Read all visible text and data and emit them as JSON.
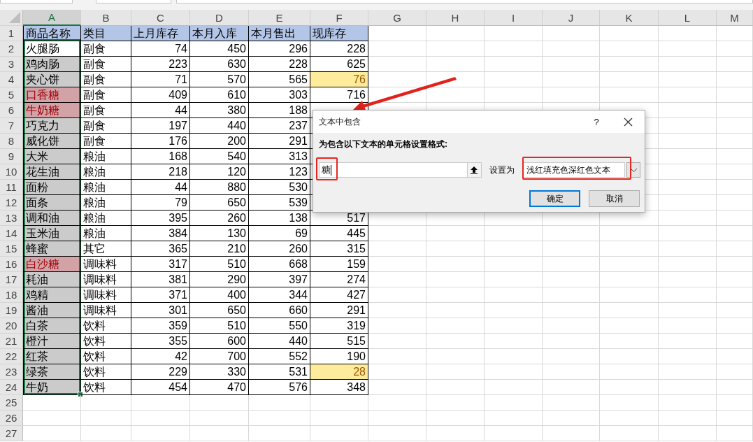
{
  "columns": [
    {
      "label": "A",
      "selected": true
    },
    {
      "label": "B",
      "selected": false
    },
    {
      "label": "C",
      "selected": false
    },
    {
      "label": "D",
      "selected": false
    },
    {
      "label": "E",
      "selected": false
    },
    {
      "label": "F",
      "selected": false
    },
    {
      "label": "G",
      "selected": false
    },
    {
      "label": "H",
      "selected": false
    },
    {
      "label": "I",
      "selected": false
    },
    {
      "label": "J",
      "selected": false
    },
    {
      "label": "K",
      "selected": false
    },
    {
      "label": "L",
      "selected": false
    },
    {
      "label": "M",
      "selected": false
    }
  ],
  "header_row": {
    "number": "1",
    "cells": [
      "商品名称",
      "类目",
      "上月库存",
      "本月入库",
      "本月售出",
      "现库存"
    ]
  },
  "data_rows": [
    {
      "number": "2",
      "name": "火腿肠",
      "name_active": true,
      "name_highlighted": false,
      "category": "副食",
      "last_month": "74",
      "received": "450",
      "sold": "296",
      "stock": "228",
      "stock_low": false
    },
    {
      "number": "3",
      "name": "鸡肉肠",
      "name_active": false,
      "name_highlighted": false,
      "category": "副食",
      "last_month": "223",
      "received": "630",
      "sold": "228",
      "stock": "625",
      "stock_low": false
    },
    {
      "number": "4",
      "name": "夹心饼",
      "name_active": false,
      "name_highlighted": false,
      "category": "副食",
      "last_month": "71",
      "received": "570",
      "sold": "565",
      "stock": "76",
      "stock_low": true
    },
    {
      "number": "5",
      "name": "口香糖",
      "name_active": false,
      "name_highlighted": true,
      "category": "副食",
      "last_month": "409",
      "received": "610",
      "sold": "303",
      "stock": "716",
      "stock_low": false
    },
    {
      "number": "6",
      "name": "牛奶糖",
      "name_active": false,
      "name_highlighted": true,
      "category": "副食",
      "last_month": "44",
      "received": "380",
      "sold": "188"
    },
    {
      "number": "7",
      "name": "巧克力",
      "name_active": false,
      "name_highlighted": false,
      "category": "副食",
      "last_month": "197",
      "received": "440",
      "sold": "237"
    },
    {
      "number": "8",
      "name": "威化饼",
      "name_active": false,
      "name_highlighted": false,
      "category": "副食",
      "last_month": "176",
      "received": "200",
      "sold": "291"
    },
    {
      "number": "9",
      "name": "大米",
      "name_active": false,
      "name_highlighted": false,
      "category": "粮油",
      "last_month": "168",
      "received": "540",
      "sold": "313"
    },
    {
      "number": "10",
      "name": "花生油",
      "name_active": false,
      "name_highlighted": false,
      "category": "粮油",
      "last_month": "218",
      "received": "120",
      "sold": "123"
    },
    {
      "number": "11",
      "name": "面粉",
      "name_active": false,
      "name_highlighted": false,
      "category": "粮油",
      "last_month": "44",
      "received": "880",
      "sold": "530"
    },
    {
      "number": "12",
      "name": "面条",
      "name_active": false,
      "name_highlighted": false,
      "category": "粮油",
      "last_month": "79",
      "received": "650",
      "sold": "539"
    },
    {
      "number": "13",
      "name": "调和油",
      "name_active": false,
      "name_highlighted": false,
      "category": "粮油",
      "last_month": "395",
      "received": "260",
      "sold": "138",
      "stock": "517",
      "stock_low": false
    },
    {
      "number": "14",
      "name": "玉米油",
      "name_active": false,
      "name_highlighted": false,
      "category": "粮油",
      "last_month": "384",
      "received": "130",
      "sold": "69",
      "stock": "445",
      "stock_low": false
    },
    {
      "number": "15",
      "name": "蜂蜜",
      "name_active": false,
      "name_highlighted": false,
      "category": "其它",
      "last_month": "365",
      "received": "210",
      "sold": "260",
      "stock": "315",
      "stock_low": false
    },
    {
      "number": "16",
      "name": "白沙糖",
      "name_active": false,
      "name_highlighted": true,
      "category": "调味料",
      "last_month": "317",
      "received": "510",
      "sold": "668",
      "stock": "159",
      "stock_low": false
    },
    {
      "number": "17",
      "name": "耗油",
      "name_active": false,
      "name_highlighted": false,
      "category": "调味料",
      "last_month": "381",
      "received": "290",
      "sold": "397",
      "stock": "274",
      "stock_low": false
    },
    {
      "number": "18",
      "name": "鸡精",
      "name_active": false,
      "name_highlighted": false,
      "category": "调味料",
      "last_month": "371",
      "received": "400",
      "sold": "344",
      "stock": "427",
      "stock_low": false
    },
    {
      "number": "19",
      "name": "酱油",
      "name_active": false,
      "name_highlighted": false,
      "category": "调味料",
      "last_month": "301",
      "received": "650",
      "sold": "660",
      "stock": "291",
      "stock_low": false
    },
    {
      "number": "20",
      "name": "白茶",
      "name_active": false,
      "name_highlighted": false,
      "category": "饮料",
      "last_month": "359",
      "received": "510",
      "sold": "550",
      "stock": "319",
      "stock_low": false
    },
    {
      "number": "21",
      "name": "橙汁",
      "name_active": false,
      "name_highlighted": false,
      "category": "饮料",
      "last_month": "355",
      "received": "600",
      "sold": "440",
      "stock": "515",
      "stock_low": false
    },
    {
      "number": "22",
      "name": "红茶",
      "name_active": false,
      "name_highlighted": false,
      "category": "饮料",
      "last_month": "42",
      "received": "700",
      "sold": "552",
      "stock": "190",
      "stock_low": false
    },
    {
      "number": "23",
      "name": "绿茶",
      "name_active": false,
      "name_highlighted": false,
      "category": "饮料",
      "last_month": "229",
      "received": "330",
      "sold": "531",
      "stock": "28",
      "stock_low": true
    },
    {
      "number": "24",
      "name": "牛奶",
      "name_active": false,
      "name_highlighted": false,
      "category": "饮料",
      "last_month": "454",
      "received": "470",
      "sold": "576",
      "stock": "348",
      "stock_low": false
    }
  ],
  "empty_rows": [
    "25",
    "26",
    "27"
  ],
  "dialog": {
    "title": "文本中包含",
    "help": "?",
    "prompt": "为包含以下文本的单元格设置格式:",
    "input": {
      "value": "糖"
    },
    "format_label": "设置为",
    "format_select": {
      "value": "浅红填充色深红色文本"
    },
    "buttons": [
      {
        "label": "确定",
        "default": true
      },
      {
        "label": "取消",
        "default": false
      }
    ]
  }
}
